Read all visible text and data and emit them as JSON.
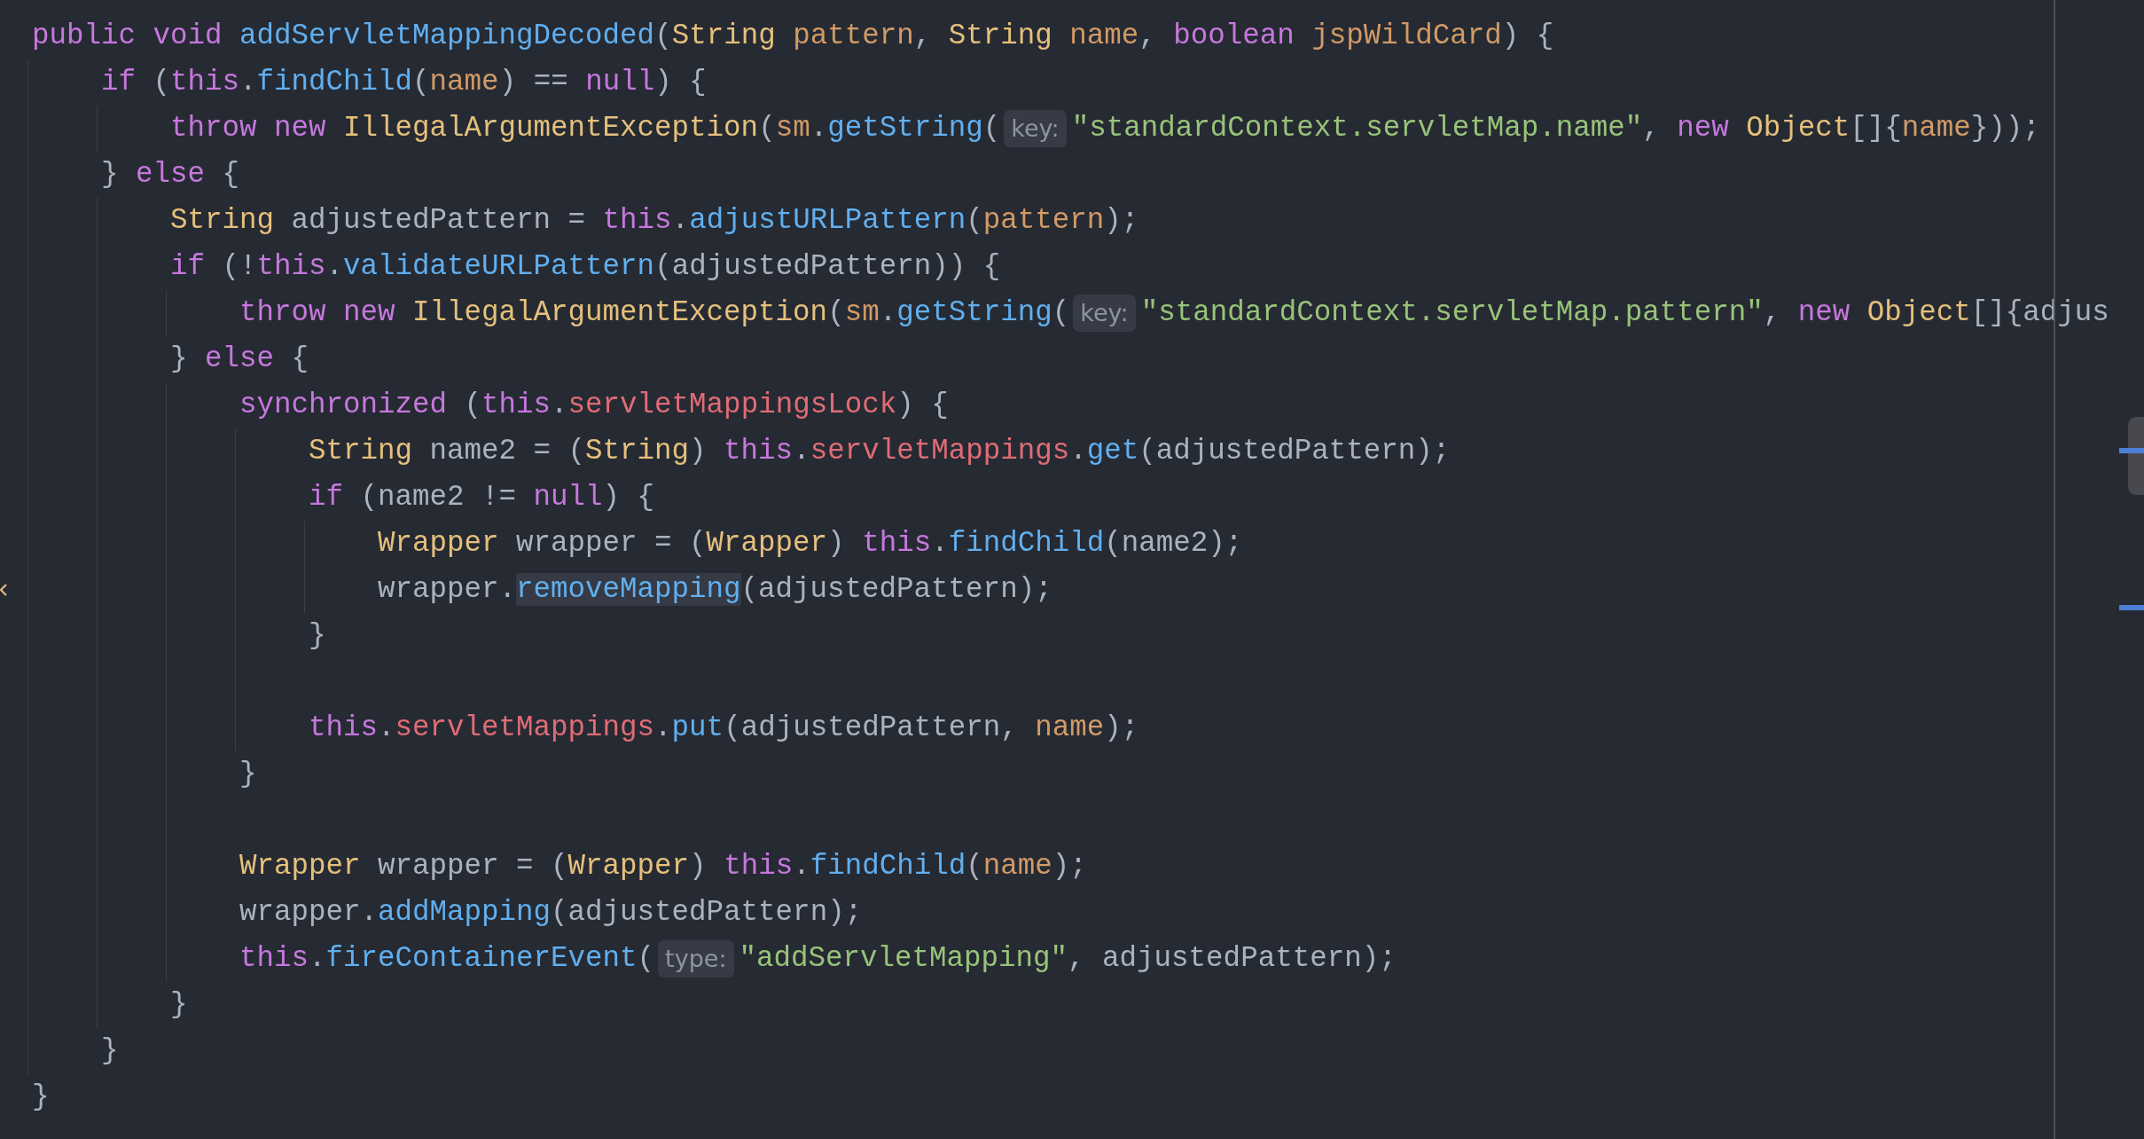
{
  "editor": {
    "lines": [
      {
        "kind": "code",
        "tokens": [
          {
            "kind": "kw",
            "text": "public void "
          },
          {
            "kind": "fn",
            "text": "addServletMappingDecoded"
          },
          {
            "kind": "p",
            "text": "("
          },
          {
            "kind": "type",
            "text": "String "
          },
          {
            "kind": "param",
            "text": "pattern"
          },
          {
            "kind": "p",
            "text": ", "
          },
          {
            "kind": "type",
            "text": "String "
          },
          {
            "kind": "param",
            "text": "name"
          },
          {
            "kind": "p",
            "text": ", "
          },
          {
            "kind": "kw",
            "text": "boolean "
          },
          {
            "kind": "param",
            "text": "jspWildCard"
          },
          {
            "kind": "p",
            "text": ") {"
          }
        ],
        "children": [
          {
            "kind": "code",
            "tokens": [
              {
                "kind": "kw",
                "text": "if "
              },
              {
                "kind": "p",
                "text": "("
              },
              {
                "kind": "kw",
                "text": "this"
              },
              {
                "kind": "p",
                "text": "."
              },
              {
                "kind": "fn",
                "text": "findChild"
              },
              {
                "kind": "p",
                "text": "("
              },
              {
                "kind": "param",
                "text": "name"
              },
              {
                "kind": "p",
                "text": ") == "
              },
              {
                "kind": "kw",
                "text": "null"
              },
              {
                "kind": "p",
                "text": ") {"
              }
            ],
            "children": [
              {
                "kind": "code",
                "tokens": [
                  {
                    "kind": "kw",
                    "text": "throw new "
                  },
                  {
                    "kind": "type",
                    "text": "IllegalArgumentException"
                  },
                  {
                    "kind": "p",
                    "text": "("
                  },
                  {
                    "kind": "param",
                    "text": "sm"
                  },
                  {
                    "kind": "p",
                    "text": "."
                  },
                  {
                    "kind": "fn",
                    "text": "getString"
                  },
                  {
                    "kind": "p",
                    "text": "("
                  },
                  {
                    "kind": "hint",
                    "text": "key:"
                  },
                  {
                    "kind": "str",
                    "text": "\"standardContext.servletMap.name\""
                  },
                  {
                    "kind": "p",
                    "text": ", "
                  },
                  {
                    "kind": "kw",
                    "text": "new "
                  },
                  {
                    "kind": "type",
                    "text": "Object"
                  },
                  {
                    "kind": "p",
                    "text": "[]{"
                  },
                  {
                    "kind": "param",
                    "text": "name"
                  },
                  {
                    "kind": "p",
                    "text": "}));"
                  }
                ]
              }
            ]
          },
          {
            "kind": "code",
            "tokens": [
              {
                "kind": "p",
                "text": "} "
              },
              {
                "kind": "kw",
                "text": "else"
              },
              {
                "kind": "p",
                "text": " {"
              }
            ],
            "children": [
              {
                "kind": "code",
                "tokens": [
                  {
                    "kind": "type",
                    "text": "String "
                  },
                  {
                    "kind": "p",
                    "text": "adjustedPattern = "
                  },
                  {
                    "kind": "kw",
                    "text": "this"
                  },
                  {
                    "kind": "p",
                    "text": "."
                  },
                  {
                    "kind": "fn",
                    "text": "adjustURLPattern"
                  },
                  {
                    "kind": "p",
                    "text": "("
                  },
                  {
                    "kind": "param",
                    "text": "pattern"
                  },
                  {
                    "kind": "p",
                    "text": ");"
                  }
                ]
              },
              {
                "kind": "code",
                "tokens": [
                  {
                    "kind": "kw",
                    "text": "if "
                  },
                  {
                    "kind": "p",
                    "text": "(!"
                  },
                  {
                    "kind": "kw",
                    "text": "this"
                  },
                  {
                    "kind": "p",
                    "text": "."
                  },
                  {
                    "kind": "fn",
                    "text": "validateURLPattern"
                  },
                  {
                    "kind": "p",
                    "text": "(adjustedPattern)) {"
                  }
                ],
                "children": [
                  {
                    "kind": "code",
                    "tokens": [
                      {
                        "kind": "kw",
                        "text": "throw new "
                      },
                      {
                        "kind": "type",
                        "text": "IllegalArgumentException"
                      },
                      {
                        "kind": "p",
                        "text": "("
                      },
                      {
                        "kind": "param",
                        "text": "sm"
                      },
                      {
                        "kind": "p",
                        "text": "."
                      },
                      {
                        "kind": "fn",
                        "text": "getString"
                      },
                      {
                        "kind": "p",
                        "text": "("
                      },
                      {
                        "kind": "hint",
                        "text": "key:"
                      },
                      {
                        "kind": "str",
                        "text": "\"standardContext.servletMap.pattern\""
                      },
                      {
                        "kind": "p",
                        "text": ", "
                      },
                      {
                        "kind": "kw",
                        "text": "new "
                      },
                      {
                        "kind": "type",
                        "text": "Object"
                      },
                      {
                        "kind": "p",
                        "text": "[]{adjus"
                      }
                    ]
                  }
                ]
              },
              {
                "kind": "code",
                "tokens": [
                  {
                    "kind": "p",
                    "text": "} "
                  },
                  {
                    "kind": "kw",
                    "text": "else"
                  },
                  {
                    "kind": "p",
                    "text": " {"
                  }
                ],
                "children": [
                  {
                    "kind": "code",
                    "tokens": [
                      {
                        "kind": "kw",
                        "text": "synchronized "
                      },
                      {
                        "kind": "p",
                        "text": "("
                      },
                      {
                        "kind": "kw",
                        "text": "this"
                      },
                      {
                        "kind": "p",
                        "text": "."
                      },
                      {
                        "kind": "field",
                        "text": "servletMappingsLock"
                      },
                      {
                        "kind": "p",
                        "text": ") {"
                      }
                    ],
                    "children": [
                      {
                        "kind": "code",
                        "tokens": [
                          {
                            "kind": "type",
                            "text": "String "
                          },
                          {
                            "kind": "p",
                            "text": "name2 = ("
                          },
                          {
                            "kind": "type",
                            "text": "String"
                          },
                          {
                            "kind": "p",
                            "text": ") "
                          },
                          {
                            "kind": "kw",
                            "text": "this"
                          },
                          {
                            "kind": "p",
                            "text": "."
                          },
                          {
                            "kind": "field",
                            "text": "servletMappings"
                          },
                          {
                            "kind": "p",
                            "text": "."
                          },
                          {
                            "kind": "fn",
                            "text": "get"
                          },
                          {
                            "kind": "p",
                            "text": "(adjustedPattern);"
                          }
                        ]
                      },
                      {
                        "kind": "code",
                        "tokens": [
                          {
                            "kind": "kw",
                            "text": "if "
                          },
                          {
                            "kind": "p",
                            "text": "(name2 != "
                          },
                          {
                            "kind": "kw",
                            "text": "null"
                          },
                          {
                            "kind": "p",
                            "text": ") {"
                          }
                        ],
                        "children": [
                          {
                            "kind": "code",
                            "tokens": [
                              {
                                "kind": "type",
                                "text": "Wrapper "
                              },
                              {
                                "kind": "p",
                                "text": "wrapper = ("
                              },
                              {
                                "kind": "type",
                                "text": "Wrapper"
                              },
                              {
                                "kind": "p",
                                "text": ") "
                              },
                              {
                                "kind": "kw",
                                "text": "this"
                              },
                              {
                                "kind": "p",
                                "text": "."
                              },
                              {
                                "kind": "fn",
                                "text": "findChild"
                              },
                              {
                                "kind": "p",
                                "text": "(name2);"
                              }
                            ]
                          },
                          {
                            "kind": "code",
                            "caret": true,
                            "tokens": [
                              {
                                "kind": "p",
                                "text": "wrapper."
                              },
                              {
                                "kind": "fn",
                                "text": "removeMapping",
                                "highlighted": true
                              },
                              {
                                "kind": "p",
                                "text": "(adjustedPattern);"
                              }
                            ]
                          }
                        ]
                      },
                      {
                        "kind": "code",
                        "tokens": [
                          {
                            "kind": "p",
                            "text": "}"
                          }
                        ]
                      },
                      {
                        "kind": "blank"
                      },
                      {
                        "kind": "code",
                        "tokens": [
                          {
                            "kind": "kw",
                            "text": "this"
                          },
                          {
                            "kind": "p",
                            "text": "."
                          },
                          {
                            "kind": "field",
                            "text": "servletMappings"
                          },
                          {
                            "kind": "p",
                            "text": "."
                          },
                          {
                            "kind": "fn",
                            "text": "put"
                          },
                          {
                            "kind": "p",
                            "text": "(adjustedPattern, "
                          },
                          {
                            "kind": "param",
                            "text": "name"
                          },
                          {
                            "kind": "p",
                            "text": ");"
                          }
                        ]
                      }
                    ]
                  },
                  {
                    "kind": "code",
                    "tokens": [
                      {
                        "kind": "p",
                        "text": "}"
                      }
                    ]
                  },
                  {
                    "kind": "blank"
                  },
                  {
                    "kind": "code",
                    "tokens": [
                      {
                        "kind": "type",
                        "text": "Wrapper "
                      },
                      {
                        "kind": "p",
                        "text": "wrapper = ("
                      },
                      {
                        "kind": "type",
                        "text": "Wrapper"
                      },
                      {
                        "kind": "p",
                        "text": ") "
                      },
                      {
                        "kind": "kw",
                        "text": "this"
                      },
                      {
                        "kind": "p",
                        "text": "."
                      },
                      {
                        "kind": "fn",
                        "text": "findChild"
                      },
                      {
                        "kind": "p",
                        "text": "("
                      },
                      {
                        "kind": "param",
                        "text": "name"
                      },
                      {
                        "kind": "p",
                        "text": ");"
                      }
                    ]
                  },
                  {
                    "kind": "code",
                    "tokens": [
                      {
                        "kind": "p",
                        "text": "wrapper."
                      },
                      {
                        "kind": "fn",
                        "text": "addMapping"
                      },
                      {
                        "kind": "p",
                        "text": "(adjustedPattern);"
                      }
                    ]
                  },
                  {
                    "kind": "code",
                    "tokens": [
                      {
                        "kind": "kw",
                        "text": "this"
                      },
                      {
                        "kind": "p",
                        "text": "."
                      },
                      {
                        "kind": "fn",
                        "text": "fireContainerEvent"
                      },
                      {
                        "kind": "p",
                        "text": "("
                      },
                      {
                        "kind": "hint",
                        "text": "type:"
                      },
                      {
                        "kind": "str",
                        "text": "\"addServletMapping\""
                      },
                      {
                        "kind": "p",
                        "text": ", adjustedPattern);"
                      }
                    ]
                  }
                ]
              },
              {
                "kind": "code",
                "tokens": [
                  {
                    "kind": "p",
                    "text": "}"
                  }
                ]
              }
            ]
          },
          {
            "kind": "code",
            "tokens": [
              {
                "kind": "p",
                "text": "}"
              }
            ]
          }
        ]
      },
      {
        "kind": "code",
        "tokens": [
          {
            "kind": "p",
            "text": "}"
          }
        ]
      }
    ]
  }
}
